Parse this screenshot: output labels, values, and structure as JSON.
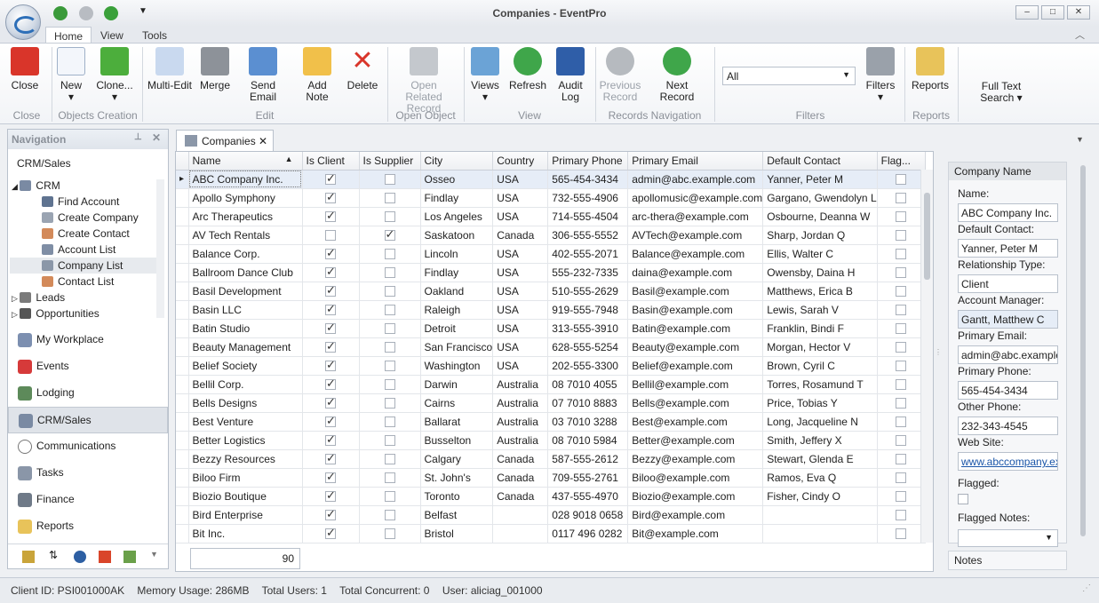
{
  "window": {
    "title": "Companies - EventPro"
  },
  "ribbon_tabs": [
    "Home",
    "View",
    "Tools"
  ],
  "ribbon": {
    "buttons": [
      {
        "label": "Close",
        "icon": "close-icon",
        "disabled": false
      },
      {
        "label": "New",
        "icon": "new-document-icon",
        "disabled": false
      },
      {
        "label": "Clone...",
        "icon": "clone-icon",
        "disabled": false
      },
      {
        "label": "Multi-Edit",
        "icon": "multi-edit-icon",
        "disabled": false
      },
      {
        "label": "Merge",
        "icon": "merge-icon",
        "disabled": false
      },
      {
        "label": "Send Email",
        "icon": "email-icon",
        "disabled": false
      },
      {
        "label": "Add Note",
        "icon": "note-icon",
        "disabled": false
      },
      {
        "label": "Delete",
        "icon": "delete-icon",
        "disabled": false
      },
      {
        "label": "Open Related Record",
        "icon": "open-related-icon",
        "disabled": true
      },
      {
        "label": "Views",
        "icon": "views-icon",
        "disabled": false
      },
      {
        "label": "Refresh",
        "icon": "refresh-icon",
        "disabled": false
      },
      {
        "label": "Audit Log",
        "icon": "audit-log-icon",
        "disabled": false
      },
      {
        "label": "Previous Record",
        "icon": "previous-record-icon",
        "disabled": true
      },
      {
        "label": "Next Record",
        "icon": "next-record-icon",
        "disabled": false
      },
      {
        "label": "Filters",
        "icon": "filter-icon",
        "disabled": false
      },
      {
        "label": "Reports",
        "icon": "reports-icon",
        "disabled": false
      },
      {
        "label": "Full Text Search",
        "icon": "",
        "disabled": false
      }
    ],
    "groups": [
      "Close",
      "Objects Creation",
      "Edit",
      "Open Object",
      "View",
      "Records Navigation",
      "Filters",
      "Reports"
    ],
    "filter_value": "All"
  },
  "navigation": {
    "title": "Navigation",
    "section": "CRM/Sales",
    "tree": [
      {
        "label": "CRM",
        "level": 0
      },
      {
        "label": "Find Account",
        "level": 1
      },
      {
        "label": "Create Company",
        "level": 1
      },
      {
        "label": "Create Contact",
        "level": 1
      },
      {
        "label": "Account List",
        "level": 1
      },
      {
        "label": "Company List",
        "level": 1
      },
      {
        "label": "Contact List",
        "level": 1
      },
      {
        "label": "Leads",
        "level": 0
      },
      {
        "label": "Opportunities",
        "level": 0
      }
    ],
    "buttons": [
      "My Workplace",
      "Events",
      "Lodging",
      "CRM/Sales",
      "Communications",
      "Tasks",
      "Finance",
      "Reports"
    ]
  },
  "document_tab": "Companies",
  "grid": {
    "columns": [
      "Name",
      "Is Client",
      "Is Supplier",
      "City",
      "Country",
      "Primary Phone",
      "Primary Email",
      "Default Contact",
      "Flag..."
    ],
    "rows": [
      [
        "ABC Company Inc.",
        true,
        false,
        "Osseo",
        "USA",
        "565-454-3434",
        "admin@abc.example.com",
        "Yanner, Peter M",
        false
      ],
      [
        "Apollo Symphony",
        true,
        false,
        "Findlay",
        "USA",
        "732-555-4906",
        "apollomusic@example.com",
        "Gargano, Gwendolyn L",
        false
      ],
      [
        "Arc Therapeutics",
        true,
        false,
        "Los Angeles",
        "USA",
        "714-555-4504",
        "arc-thera@example.com",
        "Osbourne, Deanna W",
        false
      ],
      [
        "AV Tech Rentals",
        false,
        true,
        "Saskatoon",
        "Canada",
        "306-555-5552",
        "AVTech@example.com",
        "Sharp, Jordan Q",
        false
      ],
      [
        "Balance Corp.",
        true,
        false,
        "Lincoln",
        "USA",
        "402-555-2071",
        "Balance@example.com",
        "Ellis, Walter C",
        false
      ],
      [
        "Ballroom Dance Club",
        true,
        false,
        "Findlay",
        "USA",
        "555-232-7335",
        "daina@example.com",
        "Owensby, Daina H",
        false
      ],
      [
        "Basil Development",
        true,
        false,
        "Oakland",
        "USA",
        "510-555-2629",
        "Basil@example.com",
        "Matthews, Erica B",
        false
      ],
      [
        "Basin LLC",
        true,
        false,
        "Raleigh",
        "USA",
        "919-555-7948",
        "Basin@example.com",
        "Lewis, Sarah V",
        false
      ],
      [
        "Batin Studio",
        true,
        false,
        "Detroit",
        "USA",
        "313-555-3910",
        "Batin@example.com",
        "Franklin, Bindi F",
        false
      ],
      [
        "Beauty Management",
        true,
        false,
        "San Francisco",
        "USA",
        "628-555-5254",
        "Beauty@example.com",
        "Morgan, Hector V",
        false
      ],
      [
        "Belief Society",
        true,
        false,
        "Washington",
        "USA",
        "202-555-3300",
        "Belief@example.com",
        "Brown, Cyril C",
        false
      ],
      [
        "Bellil Corp.",
        true,
        false,
        "Darwin",
        "Australia",
        "08 7010 4055",
        "Bellil@example.com",
        "Torres, Rosamund T",
        false
      ],
      [
        "Bells Designs",
        true,
        false,
        "Cairns",
        "Australia",
        "07 7010 8883",
        "Bells@example.com",
        "Price, Tobias Y",
        false
      ],
      [
        "Best Venture",
        true,
        false,
        "Ballarat",
        "Australia",
        "03 7010 3288",
        "Best@example.com",
        "Long, Jacqueline N",
        false
      ],
      [
        "Better Logistics",
        true,
        false,
        "Busselton",
        "Australia",
        "08 7010 5984",
        "Better@example.com",
        "Smith, Jeffery X",
        false
      ],
      [
        "Bezzy Resources",
        true,
        false,
        "Calgary",
        "Canada",
        "587-555-2612",
        "Bezzy@example.com",
        "Stewart, Glenda E",
        false
      ],
      [
        "Biloo Firm",
        true,
        false,
        "St. John's",
        "Canada",
        "709-555-2761",
        "Biloo@example.com",
        "Ramos, Eva Q",
        false
      ],
      [
        "Biozio Boutique",
        true,
        false,
        "Toronto",
        "Canada",
        "437-555-4970",
        "Biozio@example.com",
        "Fisher, Cindy O",
        false
      ],
      [
        "Bird Enterprise",
        true,
        false,
        "Belfast",
        "",
        "028 9018 0658",
        "Bird@example.com",
        "",
        false
      ],
      [
        "Bit Inc.",
        true,
        false,
        "Bristol",
        "",
        "0117 496 0282",
        "Bit@example.com",
        "",
        false
      ]
    ],
    "record_count": "90"
  },
  "detail": {
    "header": "Company Name",
    "fields": [
      {
        "label": "Name:",
        "value": "ABC Company Inc."
      },
      {
        "label": "Default Contact:",
        "value": "Yanner, Peter M"
      },
      {
        "label": "Relationship Type:",
        "value": "Client"
      },
      {
        "label": "Account Manager:",
        "value": "Gantt, Matthew C"
      },
      {
        "label": "Primary Email:",
        "value": "admin@abc.example.com"
      },
      {
        "label": "Primary Phone:",
        "value": "565-454-3434"
      },
      {
        "label": "Other Phone:",
        "value": "232-343-4545"
      },
      {
        "label": "Web Site:",
        "value": "www.abccompany.example.com"
      }
    ],
    "flagged_label": "Flagged:",
    "flagged_notes_label": "Flagged Notes:",
    "notes_header": "Notes"
  },
  "status": {
    "client_id": "Client ID: PSI001000AK",
    "memory": "Memory Usage: 286MB",
    "users": "Total Users: 1",
    "concurrent": "Total Concurrent: 0",
    "user": "User: aliciag_001000"
  },
  "colors": {
    "accent": "#2d6fb8",
    "selection": "#e6edf7",
    "link": "#1a55a8"
  }
}
